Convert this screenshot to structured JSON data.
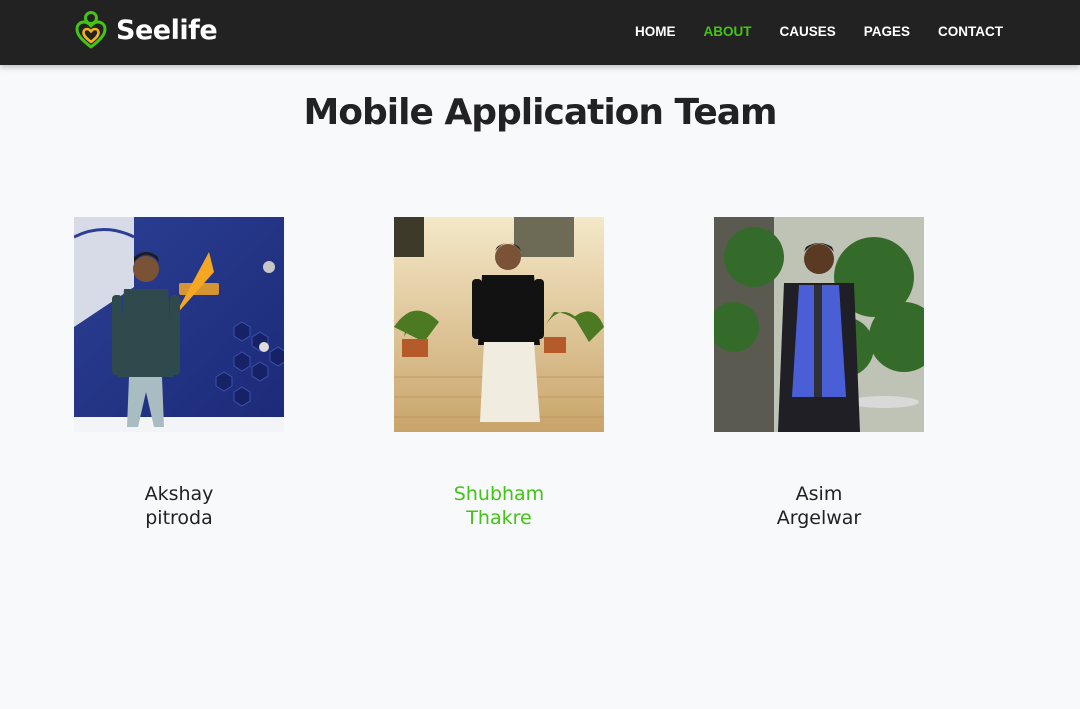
{
  "brand": {
    "name": "Seelife",
    "colors": {
      "accent": "#43c417",
      "secondary": "#f5b21a",
      "navbar": "#222222"
    }
  },
  "nav": {
    "items": [
      {
        "label": "HOME",
        "active": false
      },
      {
        "label": "ABOUT",
        "active": true
      },
      {
        "label": "CAUSES",
        "active": false
      },
      {
        "label": "PAGES",
        "active": false
      },
      {
        "label": "CONTACT",
        "active": false
      }
    ]
  },
  "section": {
    "title": "Mobile Application Team"
  },
  "team": [
    {
      "first": "Akshay",
      "last": "pitroda",
      "highlighted": false
    },
    {
      "first": "Shubham",
      "last": "Thakre",
      "highlighted": true
    },
    {
      "first": "Asim",
      "last": "Argelwar",
      "highlighted": false
    }
  ]
}
